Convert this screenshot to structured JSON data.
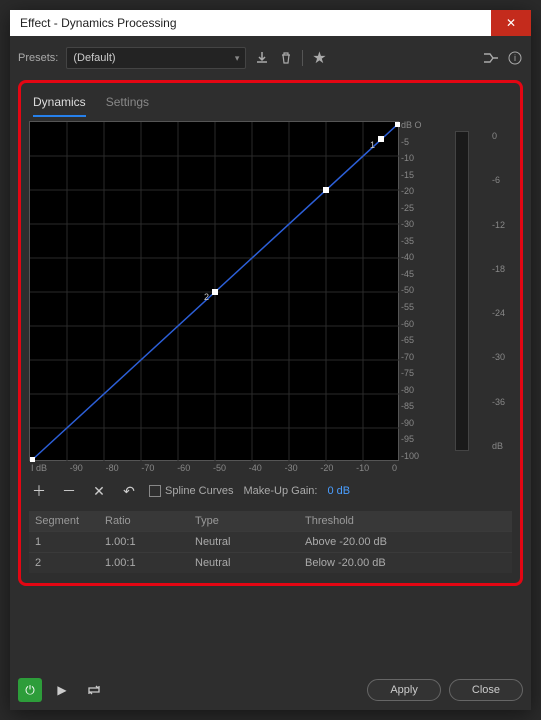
{
  "window": {
    "title": "Effect - Dynamics Processing"
  },
  "toolbar": {
    "presets_label": "Presets:",
    "preset_value": "(Default)",
    "save_icon": "download-icon",
    "delete_icon": "trash-icon",
    "favorite_icon": "star-icon",
    "route_icon": "signal-icon",
    "info_icon": "info-icon"
  },
  "tabs": {
    "dynamics": "Dynamics",
    "settings": "Settings"
  },
  "graph": {
    "y_unit": "dB O",
    "y_ticks": [
      "dB O",
      "-5",
      "-10",
      "-15",
      "-20",
      "-25",
      "-30",
      "-35",
      "-40",
      "-45",
      "-50",
      "-55",
      "-60",
      "-65",
      "-70",
      "-75",
      "-80",
      "-85",
      "-90",
      "-95",
      "-100"
    ],
    "x_ticks": [
      "I dB",
      "-90",
      "-80",
      "-70",
      "-60",
      "-50",
      "-40",
      "-30",
      "-20",
      "-10",
      "0"
    ],
    "meter_ticks": [
      "0",
      "-6",
      "-12",
      "-18",
      "-24",
      "-30",
      "-36",
      "dB"
    ]
  },
  "controls": {
    "spline_label": "Spline Curves",
    "makeup_label": "Make-Up Gain:",
    "makeup_value": "0 dB"
  },
  "segments": {
    "headers": {
      "segment": "Segment",
      "ratio": "Ratio",
      "type": "Type",
      "threshold": "Threshold"
    },
    "rows": [
      {
        "segment": "1",
        "ratio": "1.00:1",
        "type": "Neutral",
        "threshold": "Above -20.00 dB"
      },
      {
        "segment": "2",
        "ratio": "1.00:1",
        "type": "Neutral",
        "threshold": "Below -20.00 dB"
      }
    ]
  },
  "footer": {
    "apply": "Apply",
    "close": "Close"
  },
  "chart_data": {
    "type": "line",
    "title": "Dynamics Transfer Curve",
    "xlabel": "Input (dB)",
    "ylabel": "Output (dB)",
    "xlim": [
      -100,
      0
    ],
    "ylim": [
      -100,
      0
    ],
    "points": [
      {
        "x": -100,
        "y": -100
      },
      {
        "x": -50,
        "y": -50,
        "label": "2"
      },
      {
        "x": -20,
        "y": -20
      },
      {
        "x": -5,
        "y": -5,
        "label": "1"
      },
      {
        "x": 0,
        "y": 0
      }
    ]
  }
}
